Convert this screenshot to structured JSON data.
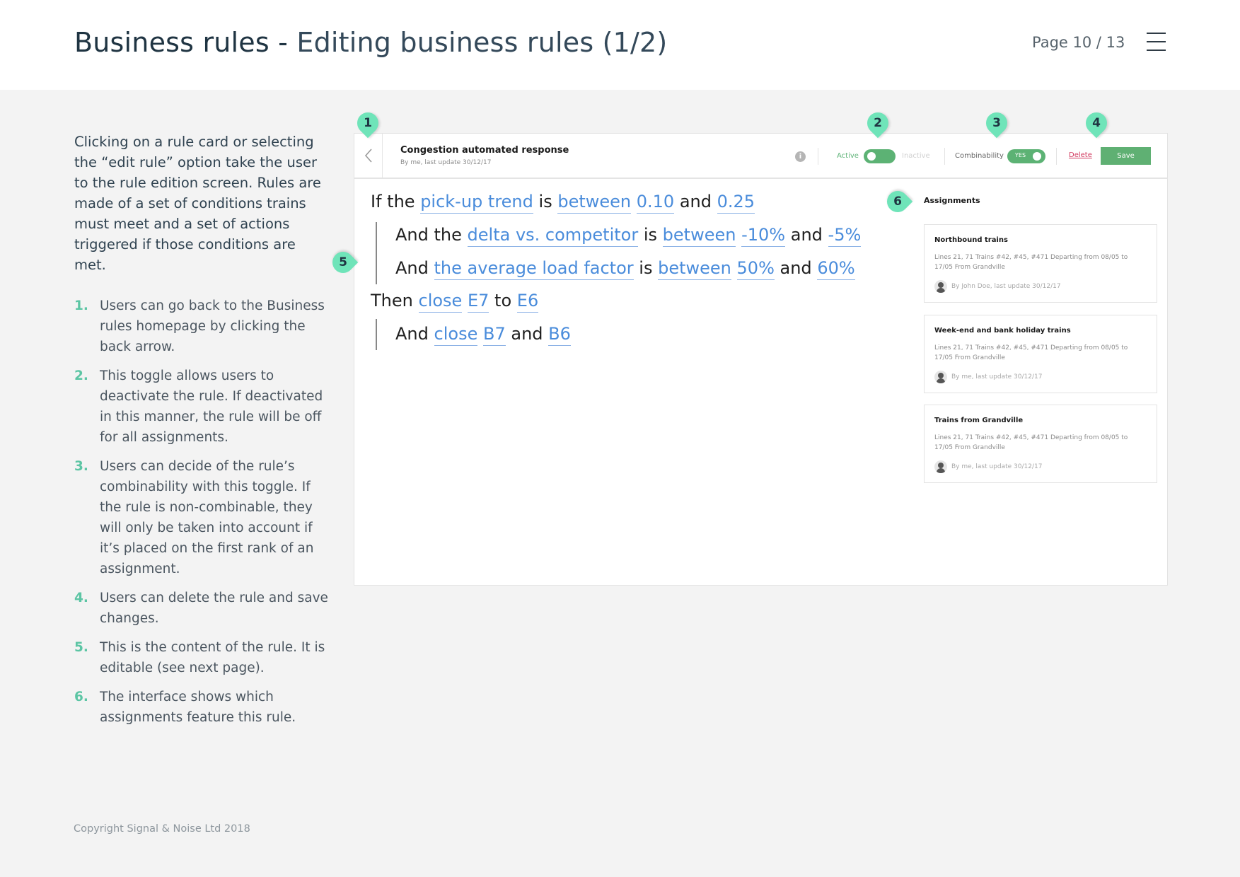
{
  "header": {
    "title_bold": "Business rules - ",
    "title_light": "Editing business rules (1/2)",
    "page_indicator": "Page 10 / 13",
    "menu_icon": "hamburger-menu-icon"
  },
  "intro": "Clicking on a rule card or selecting the “edit rule” option take the user to the rule edition screen. Rules are made of a set of conditions trains must meet and a set of actions triggered if those conditions are met.",
  "notes": [
    {
      "num": "1.",
      "text": "Users can go back to the Business rules homepage by clicking the back arrow."
    },
    {
      "num": "2.",
      "text": "This toggle allows users to deactivate the rule. If deactivated in this manner, the rule will be off for all assignments."
    },
    {
      "num": "3.",
      "text": "Users can decide of the rule’s combinability with this toggle. If the rule is non-combinable, they will only be taken into account if it’s placed on the first rank of an assignment."
    },
    {
      "num": "4.",
      "text": "Users can delete the rule and save changes."
    },
    {
      "num": "5.",
      "text": "This is the content of the rule. It is editable (see next page)."
    },
    {
      "num": "6.",
      "text": "The interface shows which assignments feature this rule."
    }
  ],
  "markers": [
    "1",
    "2",
    "3",
    "4",
    "5",
    "6"
  ],
  "rule": {
    "name": "Congestion automated response",
    "meta": "By me, last update 30/12/17",
    "active_label": "Active",
    "inactive_label": "Inactive",
    "active_on": true,
    "combinability_label": "Combinability",
    "combinability_value": "YES",
    "delete_label": "Delete",
    "save_label": "Save",
    "lines": {
      "l1": {
        "w1": "If the",
        "t1": "pick-up trend",
        "w2": "is",
        "t2": "between",
        "t3": "0.10",
        "w3": "and",
        "t4": "0.25"
      },
      "l2": {
        "w1": "And the",
        "t1": "delta vs. competitor",
        "w2": "is",
        "t2": "between",
        "t3": "-10%",
        "w3": "and",
        "t4": "-5%"
      },
      "l3": {
        "w1": "And",
        "t1": "the average load factor",
        "w2": "is",
        "t2": "between",
        "t3": "50%",
        "w3": "and",
        "t4": "60%"
      },
      "l4": {
        "w1": "Then",
        "t1": "close",
        "t2": "E7",
        "w2": "to",
        "t3": "E6"
      },
      "l5": {
        "w1": "And",
        "t1": "close",
        "t2": "B7",
        "w2": "and",
        "t3": "B6"
      }
    }
  },
  "assignments": {
    "title": "Assignments",
    "cards": [
      {
        "title": "Northbound trains",
        "desc": "Lines 21, 71 Trains #42, #45, #471 Departing from 08/05 to 17/05 From Grandville",
        "meta": "By John Doe, last update 30/12/17"
      },
      {
        "title": "Week-end and bank holiday trains",
        "desc": "Lines 21, 71 Trains #42, #45, #471 Departing from 08/05 to 17/05 From Grandville",
        "meta": "By me, last update 30/12/17"
      },
      {
        "title": "Trains from Grandville",
        "desc": "Lines 21, 71 Trains #42, #45, #471 Departing from 08/05 to 17/05 From Grandville",
        "meta": "By me, last update 30/12/17"
      }
    ]
  },
  "footer": {
    "copyright": "Copyright Signal & Noise Ltd 2018"
  },
  "colors": {
    "accent": "#5cc5a4",
    "marker": "#6fe4b9",
    "link": "#4a8cdb",
    "save": "#5fb073",
    "delete": "#d23a5f"
  }
}
